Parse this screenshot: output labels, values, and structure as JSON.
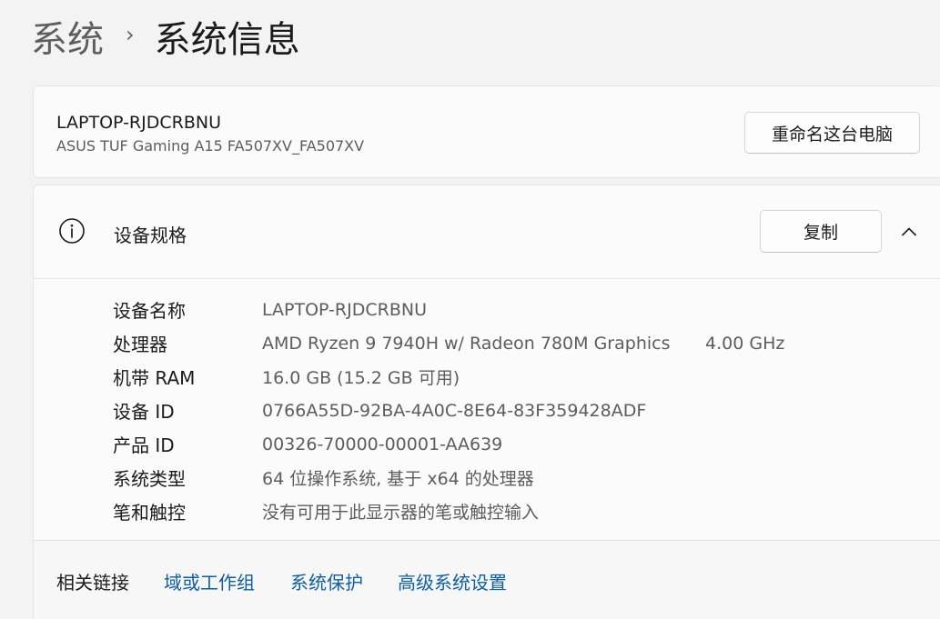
{
  "breadcrumb": {
    "parent": "系统",
    "separator": "›",
    "current": "系统信息"
  },
  "device": {
    "name": "LAPTOP-RJDCRBNU",
    "model": "ASUS TUF Gaming A15 FA507XV_FA507XV",
    "rename_label": "重命名这台电脑"
  },
  "specs": {
    "title": "设备规格",
    "copy_label": "复制",
    "icons": {
      "info": "info-icon",
      "collapse": "chevron-up-icon"
    },
    "rows": [
      {
        "label": "设备名称",
        "value": "LAPTOP-RJDCRBNU",
        "extra": ""
      },
      {
        "label": "处理器",
        "value": "AMD Ryzen 9 7940H w/ Radeon 780M Graphics",
        "extra": "4.00 GHz"
      },
      {
        "label": "机带 RAM",
        "value": "16.0 GB (15.2 GB 可用)",
        "extra": ""
      },
      {
        "label": "设备 ID",
        "value": "0766A55D-92BA-4A0C-8E64-83F359428ADF",
        "extra": ""
      },
      {
        "label": "产品 ID",
        "value": "00326-70000-00001-AA639",
        "extra": ""
      },
      {
        "label": "系统类型",
        "value": "64 位操作系统, 基于 x64 的处理器",
        "extra": ""
      },
      {
        "label": "笔和触控",
        "value": "没有可用于此显示器的笔或触控输入",
        "extra": ""
      }
    ]
  },
  "related": {
    "label": "相关链接",
    "links": [
      "域或工作组",
      "系统保护",
      "高级系统设置"
    ]
  },
  "colors": {
    "link": "#0f5ea8",
    "background": "#f3f3f3",
    "card": "#fbfbfb"
  }
}
